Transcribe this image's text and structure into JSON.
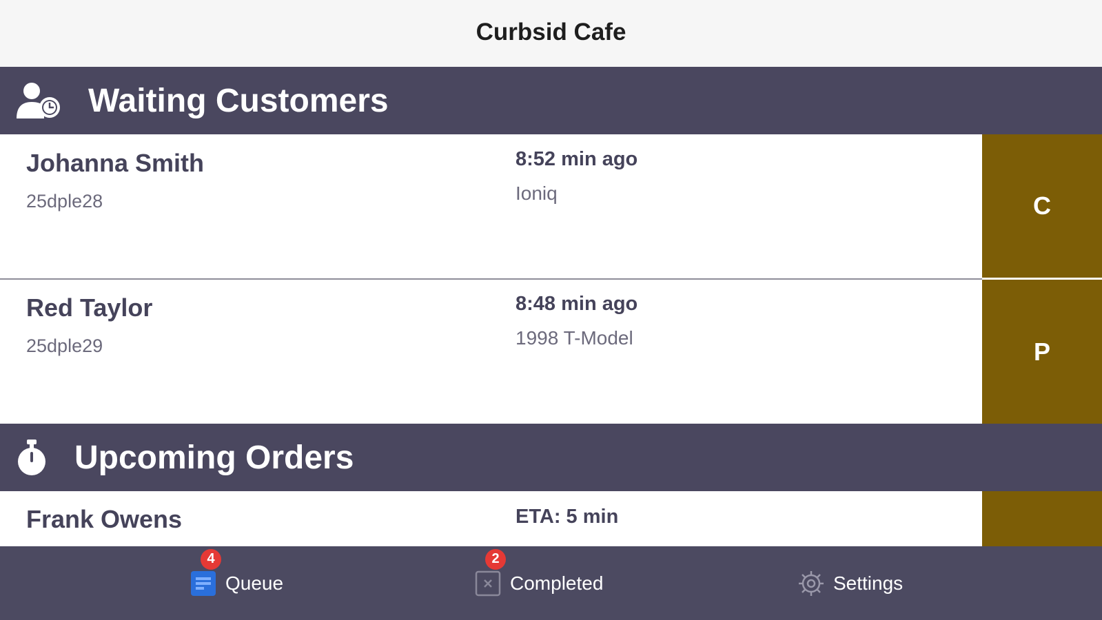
{
  "app": {
    "title": "Curbsid Cafe"
  },
  "waiting": {
    "title": "Waiting Customers",
    "icon": "user-clock-icon",
    "customers": [
      {
        "name": "Johanna Smith",
        "code": "25dple28",
        "time": "8:52 min ago",
        "vehicle": "Ioniq",
        "action": "C"
      },
      {
        "name": "Red Taylor",
        "code": "25dple29",
        "time": "8:48 min ago",
        "vehicle": "1998 T-Model",
        "action": "P"
      }
    ]
  },
  "upcoming": {
    "title": "Upcoming Orders",
    "icon": "stopwatch-icon",
    "orders": [
      {
        "name": "Frank Owens",
        "eta": "ETA: 5 min"
      }
    ]
  },
  "tabbar": {
    "tabs": [
      {
        "label": "Queue",
        "badge": "4",
        "icon": "queue-icon",
        "active": true,
        "active_color": "#2a6fdb"
      },
      {
        "label": "Completed",
        "badge": "2",
        "icon": "completed-icon",
        "active": false
      },
      {
        "label": "Settings",
        "badge": "",
        "icon": "gear-icon",
        "active": false
      }
    ]
  },
  "colors": {
    "header_bg": "#4a475f",
    "action_bg": "#7c5d06",
    "tabbar_bg": "#4c4a61",
    "badge": "#e53935"
  }
}
